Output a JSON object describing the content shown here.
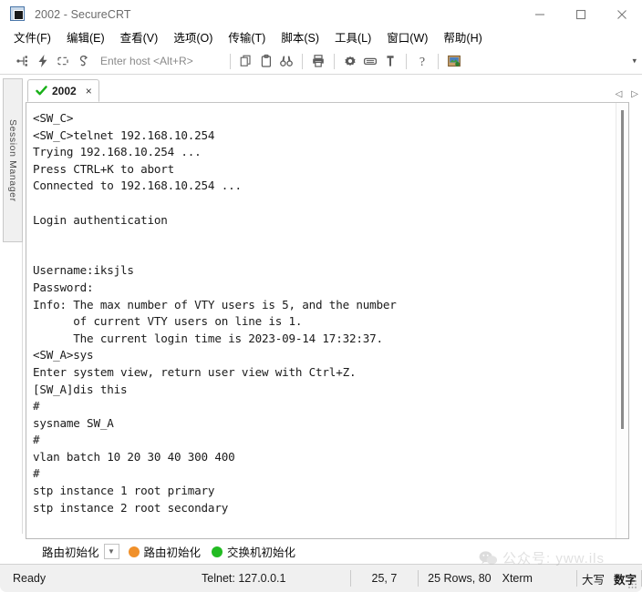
{
  "window": {
    "title": "2002 - SecureCRT",
    "icon": "securecrt-app-icon",
    "minimize": "minimize-icon",
    "maximize": "maximize-icon",
    "close": "close-icon"
  },
  "menubar": {
    "items": [
      {
        "label": "文件(F)",
        "name": "menu-file"
      },
      {
        "label": "编辑(E)",
        "name": "menu-edit"
      },
      {
        "label": "查看(V)",
        "name": "menu-view"
      },
      {
        "label": "选项(O)",
        "name": "menu-options"
      },
      {
        "label": "传输(T)",
        "name": "menu-transfer"
      },
      {
        "label": "脚本(S)",
        "name": "menu-script"
      },
      {
        "label": "工具(L)",
        "name": "menu-tools"
      },
      {
        "label": "窗口(W)",
        "name": "menu-window"
      },
      {
        "label": "帮助(H)",
        "name": "menu-help"
      }
    ]
  },
  "toolbar": {
    "host_placeholder": "Enter host <Alt+R>",
    "icons": [
      "connect-icon",
      "quick-connect-icon",
      "reconnect-icon",
      "disconnect-icon",
      "copy-icon",
      "paste-icon",
      "find-icon",
      "print-icon",
      "session-options-icon",
      "keymap-editor-icon",
      "key-icon",
      "help-icon",
      "session-manager-icon"
    ],
    "overflow": "toolbar-overflow-chevron"
  },
  "session_panel": {
    "label": "Session Manager"
  },
  "tabs": {
    "items": [
      {
        "label": "2002",
        "status_icon": "green-check-icon",
        "close": "×"
      }
    ],
    "nav_prev": "◁",
    "nav_next": "▷"
  },
  "terminal": {
    "lines": [
      "<SW_C>",
      "<SW_C>telnet 192.168.10.254",
      "Trying 192.168.10.254 ...",
      "Press CTRL+K to abort",
      "Connected to 192.168.10.254 ...",
      "",
      "Login authentication",
      "",
      "",
      "Username:iksjls",
      "Password:",
      "Info: The max number of VTY users is 5, and the number",
      "      of current VTY users on line is 1.",
      "      The current login time is 2023-09-14 17:32:37.",
      "<SW_A>sys",
      "Enter system view, return user view with Ctrl+Z.",
      "[SW_A]dis this",
      "#",
      "sysname SW_A",
      "#",
      "vlan batch 10 20 30 40 300 400",
      "#",
      "stp instance 1 root primary",
      "stp instance 2 root secondary"
    ]
  },
  "button_bar": {
    "dropdown_label": "路由初始化",
    "buttons": [
      {
        "label": "路由初始化",
        "color": "#f0902a",
        "name": "button-router-init"
      },
      {
        "label": "交换机初始化",
        "color": "#22bb22",
        "name": "button-switch-init"
      }
    ]
  },
  "status_bar": {
    "ready": "Ready",
    "connection": "Telnet: 127.0.0.1",
    "cursor": "25,  7",
    "dimensions": "25 Rows, 80",
    "emulation": "Xterm",
    "ime_caps": "大写",
    "ime_num": "数字"
  },
  "watermark": {
    "text": "公众号: yww.ils",
    "icon": "wechat-icon"
  }
}
